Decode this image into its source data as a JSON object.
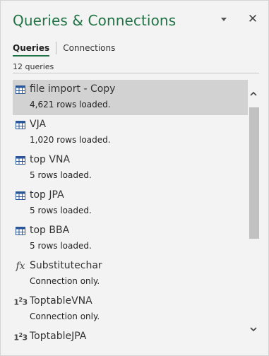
{
  "pane": {
    "title": "Queries & Connections",
    "tabs": [
      {
        "label": "Queries",
        "active": true
      },
      {
        "label": "Connections",
        "active": false
      }
    ],
    "query_count": "12 queries"
  },
  "queries": [
    {
      "name": "file import - Copy",
      "status": "4,621 rows loaded.",
      "icon": "table-icon",
      "selected": true
    },
    {
      "name": "VJA",
      "status": "1,020 rows loaded.",
      "icon": "table-icon",
      "selected": false
    },
    {
      "name": "top VNA",
      "status": "5 rows loaded.",
      "icon": "table-icon",
      "selected": false
    },
    {
      "name": "top JPA",
      "status": "5 rows loaded.",
      "icon": "table-icon",
      "selected": false
    },
    {
      "name": "top BBA",
      "status": "5 rows loaded.",
      "icon": "table-icon",
      "selected": false
    },
    {
      "name": "Substitutechar",
      "status": "Connection only.",
      "icon": "function-icon",
      "selected": false
    },
    {
      "name": "ToptableVNA",
      "status": "Connection only.",
      "icon": "number-icon",
      "selected": false
    },
    {
      "name": "ToptableJPA",
      "status": "",
      "icon": "number-icon",
      "selected": false
    }
  ],
  "colors": {
    "accent": "#217346",
    "selected_row": "#d2d2d2",
    "table_icon": "#2b579a"
  }
}
